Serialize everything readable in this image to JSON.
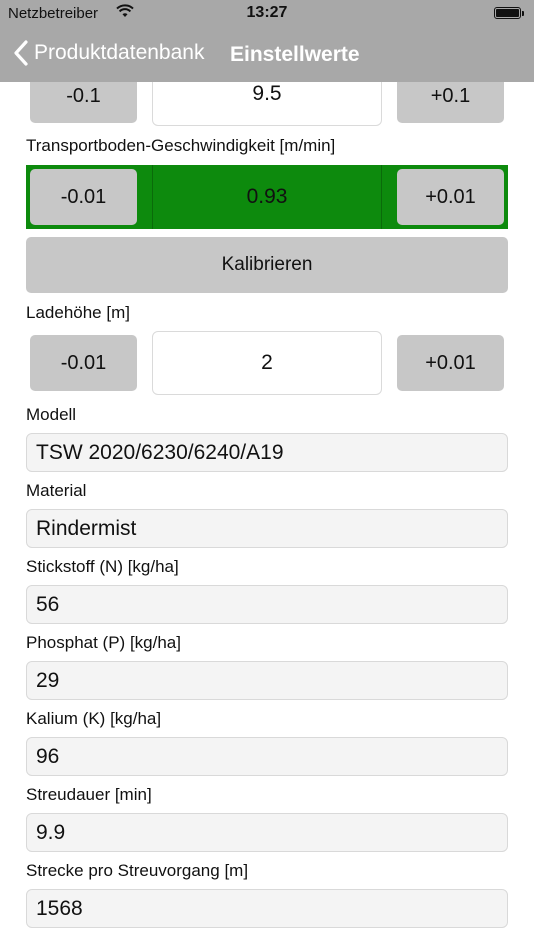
{
  "status_bar": {
    "carrier": "Netzbetreiber",
    "time": "13:27"
  },
  "nav": {
    "back_label": "Produktdatenbank",
    "title": "Einstellwerte"
  },
  "top_row": {
    "minus": "-0.1",
    "value": "9.5",
    "plus": "+0.1"
  },
  "transport": {
    "label": "Transportboden-Geschwindigkeit [m/min]",
    "minus": "-0.01",
    "value": "0.93",
    "plus": "+0.01",
    "highlight_color": "#0d8a0d"
  },
  "calibrate_label": "Kalibrieren",
  "ladehoehe": {
    "label": "Ladehöhe [m]",
    "minus": "-0.01",
    "value": "2",
    "plus": "+0.01"
  },
  "fields": [
    {
      "label": "Modell",
      "value": "TSW 2020/6230/6240/A19"
    },
    {
      "label": "Material",
      "value": "Rindermist"
    },
    {
      "label": "Stickstoff (N) [kg/ha]",
      "value": "56"
    },
    {
      "label": "Phosphat (P) [kg/ha]",
      "value": "29"
    },
    {
      "label": "Kalium (K) [kg/ha]",
      "value": "96"
    },
    {
      "label": "Streudauer [min]",
      "value": "9.9"
    },
    {
      "label": "Strecke pro Streuvorgang [m]",
      "value": "1568"
    }
  ]
}
